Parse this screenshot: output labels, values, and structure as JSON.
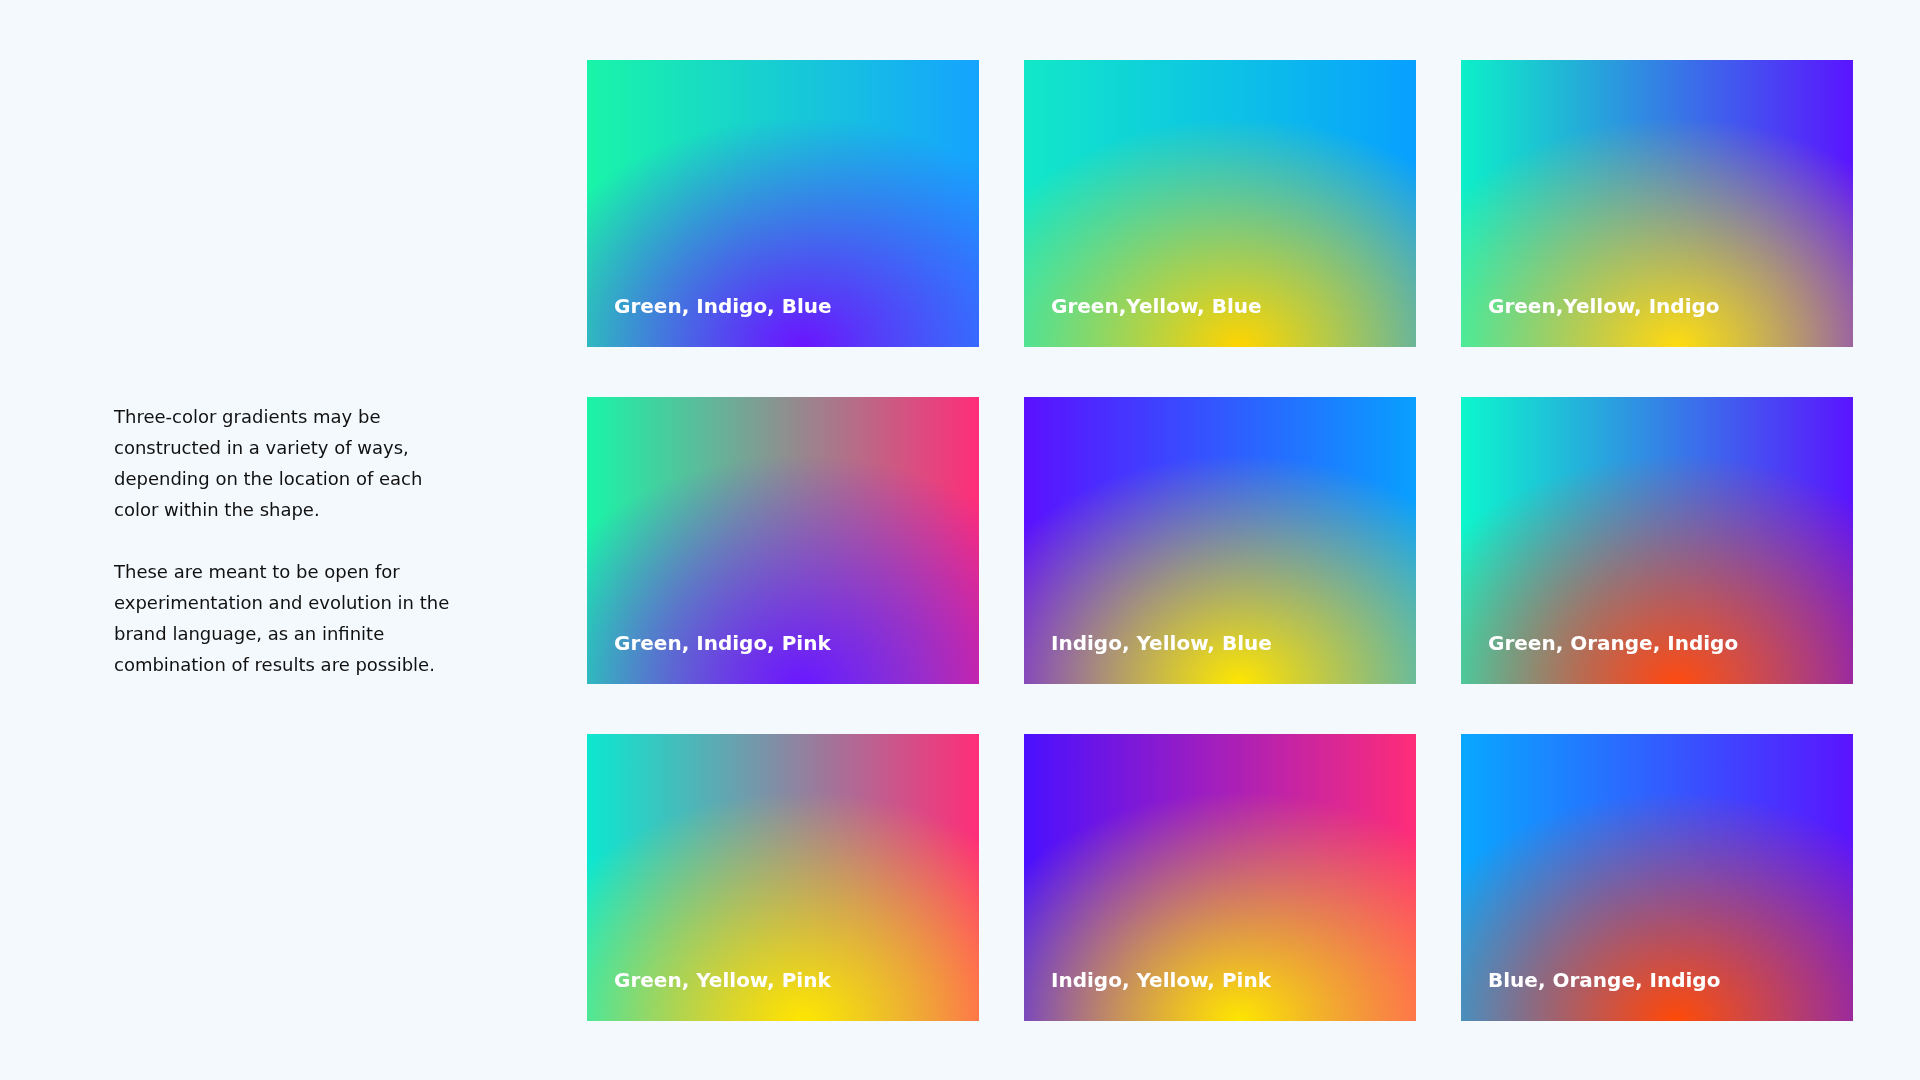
{
  "description": {
    "paragraphs": [
      "Three-color gradients may be constructed in a variety of ways, depending on the location of each color within the shape.",
      "These are meant to be open for experimentation and evolution in the brand language, as an infinite combination of results are possible."
    ]
  },
  "swatches": [
    {
      "label": "Green, Indigo, Blue"
    },
    {
      "label": "Green,Yellow, Blue"
    },
    {
      "label": "Green,Yellow, Indigo"
    },
    {
      "label": "Green, Indigo, Pink"
    },
    {
      "label": "Indigo, Yellow, Blue"
    },
    {
      "label": "Green, Orange, Indigo"
    },
    {
      "label": "Green, Yellow, Pink"
    },
    {
      "label": "Indigo, Yellow, Pink"
    },
    {
      "label": "Blue, Orange, Indigo"
    }
  ]
}
